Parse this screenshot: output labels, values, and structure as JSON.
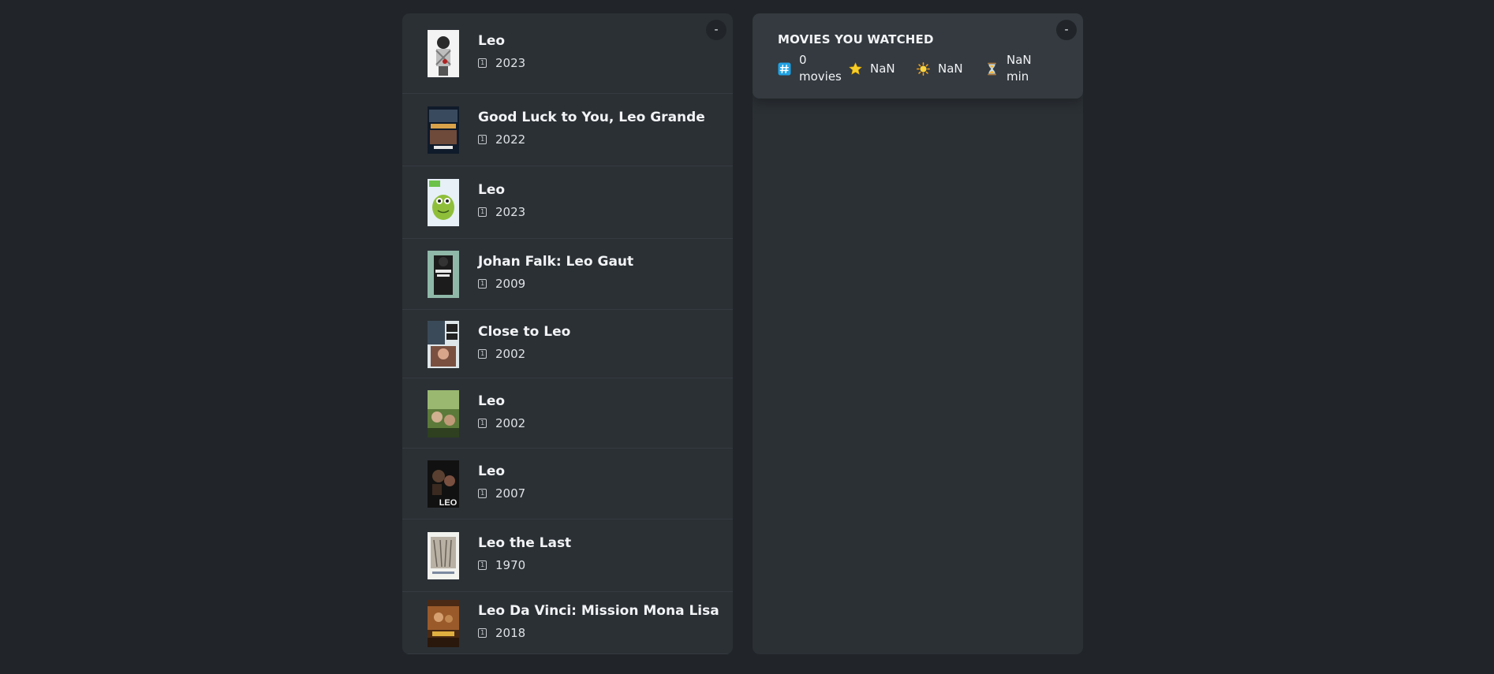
{
  "watched_list": {
    "toggle_label": "-",
    "movies": [
      {
        "title": "Leo",
        "year": "2023",
        "poster": "poster-leo-2023-a"
      },
      {
        "title": "Good Luck to You, Leo Grande",
        "year": "2022",
        "poster": "poster-good-luck-leo-grande"
      },
      {
        "title": "Leo",
        "year": "2023",
        "poster": "poster-leo-2023-b"
      },
      {
        "title": "Johan Falk: Leo Gaut",
        "year": "2009",
        "poster": "poster-johan-falk"
      },
      {
        "title": "Close to Leo",
        "year": "2002",
        "poster": "poster-close-to-leo"
      },
      {
        "title": "Leo",
        "year": "2002",
        "poster": "poster-leo-2002"
      },
      {
        "title": "Leo",
        "year": "2007",
        "poster": "poster-leo-2007"
      },
      {
        "title": "Leo the Last",
        "year": "1970",
        "poster": "poster-leo-the-last"
      },
      {
        "title": "Leo Da Vinci: Mission Mona Lisa",
        "year": "2018",
        "poster": "poster-leo-da-vinci"
      }
    ]
  },
  "summary": {
    "toggle_label": "-",
    "heading": "MOVIES YOU WATCHED",
    "count_number": "0",
    "count_unit": "movies",
    "imdb_rating": "NaN",
    "user_rating": "NaN",
    "runtime_value": "NaN",
    "runtime_unit": "min",
    "icons": [
      "hash-icon",
      "star-icon",
      "sun-icon",
      "hourglass-icon"
    ]
  },
  "colors": {
    "page_bg": "#212529",
    "box_bg": "#2b3035",
    "summary_bg": "#343a40",
    "text": "#dee2e6"
  }
}
